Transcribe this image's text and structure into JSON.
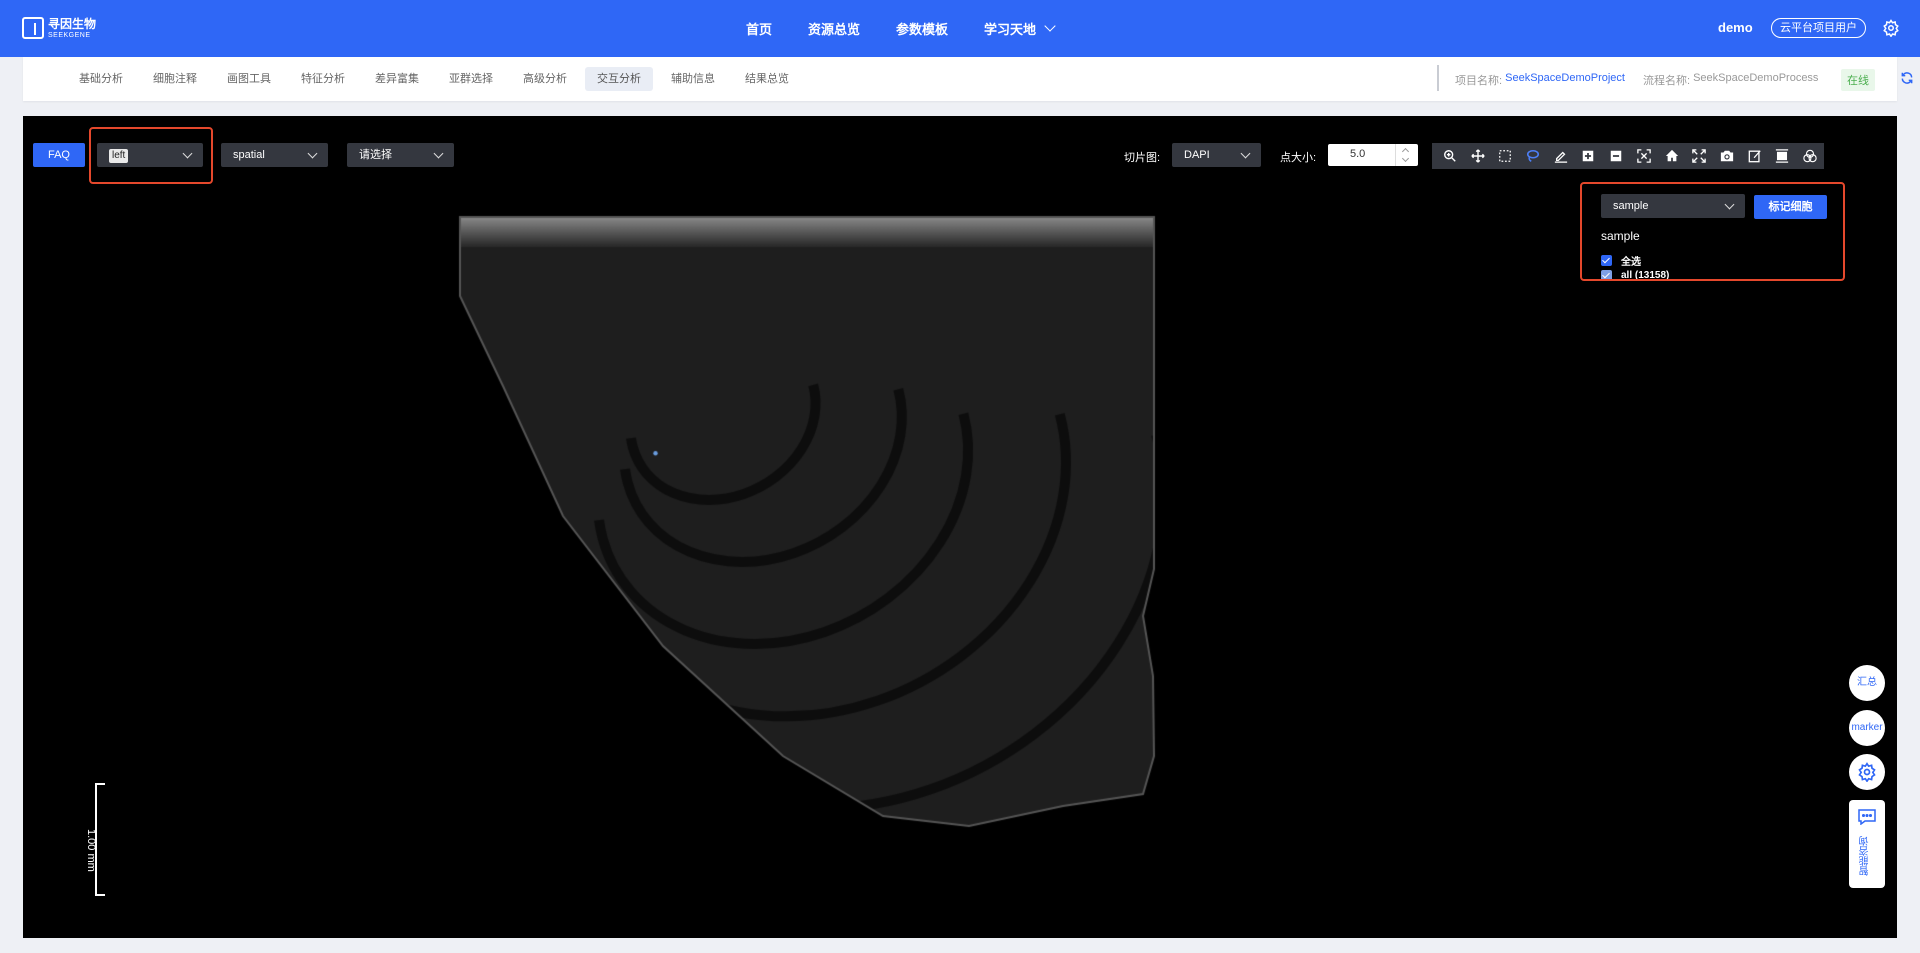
{
  "brand": {
    "name_cn": "寻因生物",
    "name_en": "SEEKGENE"
  },
  "main_nav": [
    {
      "label": "首页"
    },
    {
      "label": "资源总览"
    },
    {
      "label": "参数模板"
    },
    {
      "label": "学习天地"
    }
  ],
  "user": {
    "name": "demo",
    "role": "云平台项目用户"
  },
  "tabs": [
    {
      "label": "基础分析"
    },
    {
      "label": "细胞注释"
    },
    {
      "label": "画图工具"
    },
    {
      "label": "特征分析"
    },
    {
      "label": "差异富集"
    },
    {
      "label": "亚群选择"
    },
    {
      "label": "高级分析"
    },
    {
      "label": "交互分析"
    },
    {
      "label": "辅助信息"
    },
    {
      "label": "结果总览"
    }
  ],
  "active_tab": "交互分析",
  "project": {
    "name_label": "项目名称:",
    "name": "SeekSpaceDemoProject",
    "process_label": "流程名称:",
    "process": "SeekSpaceDemoProcess",
    "status": "在线"
  },
  "viewer": {
    "faq_label": "FAQ",
    "sample_select": "left",
    "embedding_select": "spatial",
    "third_select_placeholder": "请选择",
    "slice_label": "切片图:",
    "slice_value": "DAPI",
    "point_size_label": "点大小:",
    "point_size": "5.0",
    "toolbar_icons": [
      "zoom-in-icon",
      "pan-icon",
      "box-select-icon",
      "lasso-select-icon",
      "draw-icon",
      "add-icon",
      "remove-icon",
      "reset-axes-icon",
      "home-icon",
      "fullscreen-icon",
      "camera-icon",
      "edit-icon",
      "autoscale-icon",
      "venn-icon"
    ],
    "legend": {
      "group_select": "sample",
      "mark_button": "标记细胞",
      "title": "sample",
      "select_all": "全选",
      "items": [
        {
          "label": "all (13158)"
        }
      ]
    },
    "scale_bar": "1.00 mm",
    "point_color": "#6a9de0"
  },
  "float_buttons": {
    "summary": "汇总",
    "marker": "marker",
    "chat": "智能咨询"
  }
}
